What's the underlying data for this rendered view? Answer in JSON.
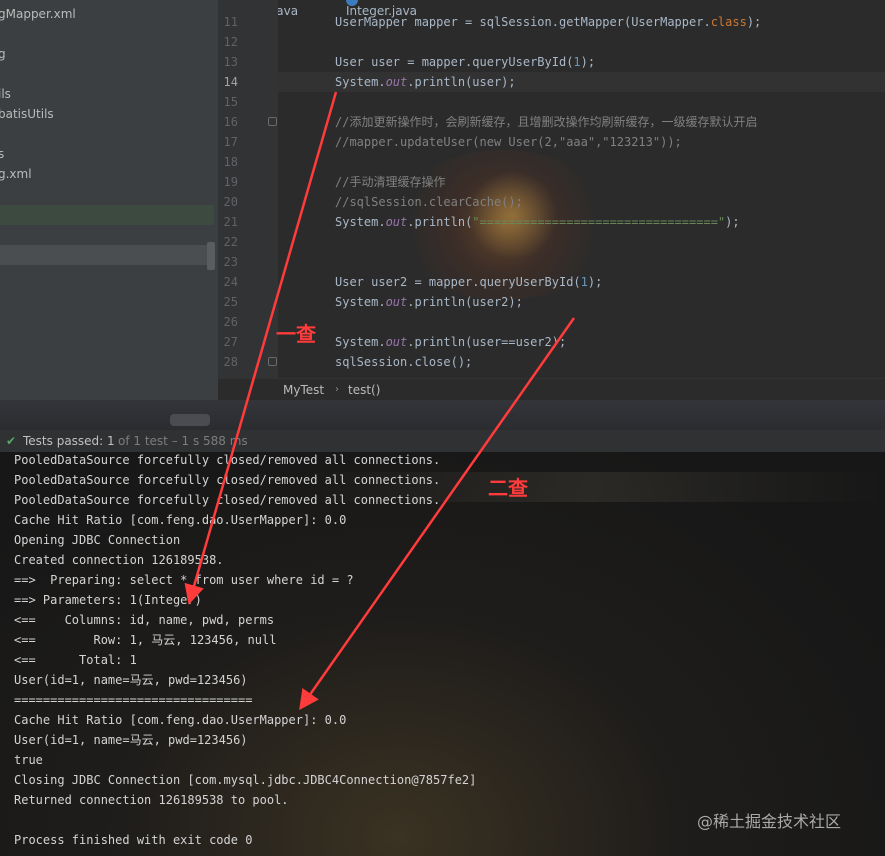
{
  "sidebar": {
    "items": [
      "gMapper.xml",
      "g",
      "ils",
      "batisUtils",
      "s",
      "g.xml"
    ]
  },
  "tabs": [
    "MyTest.java",
    "Integer.java"
  ],
  "editor": {
    "line_numbers": [
      "11",
      "12",
      "13",
      "14",
      "15",
      "16",
      "17",
      "18",
      "19",
      "20",
      "21",
      "22",
      "23",
      "24",
      "25",
      "26",
      "27",
      "28"
    ],
    "current_line": "14"
  },
  "breadcrumb": {
    "class_name": "MyTest",
    "method_name": "test()"
  },
  "test_status": {
    "label": "Tests passed:",
    "count": "1",
    "detail": "of 1 test – 1 s 588 ms"
  },
  "console_lines": [
    "PooledDataSource forcefully closed/removed all connections.",
    "PooledDataSource forcefully closed/removed all connections.",
    "PooledDataSource forcefully closed/removed all connections.",
    "Cache Hit Ratio [com.feng.dao.UserMapper]: 0.0",
    "Opening JDBC Connection",
    "Created connection 126189538.",
    "==>  Preparing: select * from user where id = ?",
    "==> Parameters: 1(Integer)",
    "<==    Columns: id, name, pwd, perms",
    "<==        Row: 1, 马云, 123456, null",
    "<==      Total: 1",
    "User(id=1, name=马云, pwd=123456)",
    "=================================",
    "Cache Hit Ratio [com.feng.dao.UserMapper]: 0.0",
    "User(id=1, name=马云, pwd=123456)",
    "true",
    "Closing JDBC Connection [com.mysql.jdbc.JDBC4Connection@7857fe2]",
    "Returned connection 126189538 to pool.",
    "",
    "Process finished with exit code 0"
  ],
  "annotations": {
    "first_query": "一查",
    "second_query": "二查"
  },
  "watermark": "@稀土掘金技术社区",
  "colors": {
    "annotation_red": "#ff3b3b",
    "pass_green": "#59a869"
  }
}
